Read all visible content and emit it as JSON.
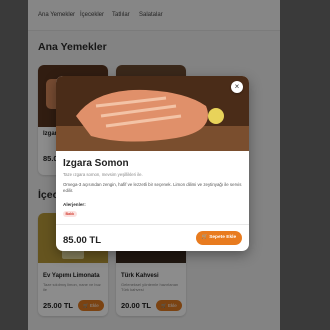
{
  "nav": {
    "tabs": [
      "Ana Yemekler",
      "İçecekler",
      "Tatlılar",
      "Salatalar"
    ]
  },
  "sections": {
    "main_title": "Ana Yemekler",
    "drinks_title": "İçecekler"
  },
  "cards": [
    {
      "name": "Izgara Somon",
      "price": "85.00 TL"
    },
    {
      "name": "Ev Yapımı Limonata",
      "desc": "Taze sıkılmış limon, nane ve buz ile",
      "price": "25.00 TL",
      "add_label": "Ekle"
    },
    {
      "name": "Türk Kahvesi",
      "desc": "Geleneksel yöntemle hazırlanan Türk kahvesi",
      "price": "20.00 TL",
      "add_label": "Ekle"
    }
  ],
  "modal": {
    "close_symbol": "×",
    "title": "Izgara Somon",
    "subtitle": "Taze ızgara somon, mevsim yeşillikleri ile.",
    "description": "Omega-3 açısından zengin, hafif ve lezzetli bir seçenek. Limon dilimi ve zeytinyağı ile servis edilir.",
    "allergens_label": "Alerjenler:",
    "allergens": [
      "Balık"
    ],
    "price": "85.00 TL",
    "add_label": "Sepete Ekle",
    "add_icon": "cart-icon"
  },
  "colors": {
    "accent": "#e87b1f",
    "allergen_badge": "#d23b30"
  }
}
